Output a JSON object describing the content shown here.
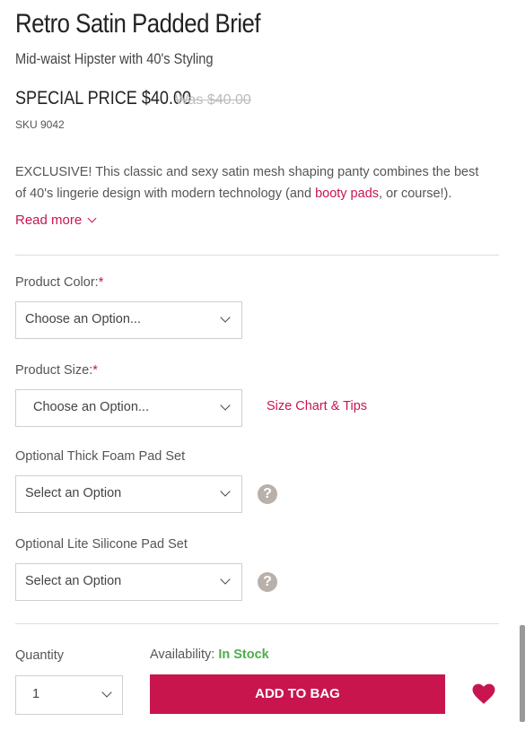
{
  "product": {
    "title": "Retro Satin Padded Brief",
    "subtitle": "Mid-waist Hipster with 40's Styling",
    "special_price": "SPECIAL PRICE $40.00",
    "was_price": "Was $40.00",
    "sku": "SKU 9042",
    "description_before": "EXCLUSIVE! This classic and sexy satin mesh shaping panty combines the best of 40's lingerie design with modern technology (and ",
    "description_link": "booty pads",
    "description_after": ", or course!).",
    "read_more": "Read more"
  },
  "options": {
    "color_label": "Product Color:",
    "color_required": "*",
    "color_value": "Choose an Option...",
    "size_label": "Product Size:",
    "size_required": "*",
    "size_value": "Choose an Option...",
    "size_chart_link": "Size Chart & Tips",
    "foam_label": "Optional Thick Foam Pad Set",
    "foam_value": "Select an Option",
    "silicone_label": "Optional Lite Silicone Pad Set",
    "silicone_value": "Select an Option",
    "help_glyph": "?"
  },
  "purchase": {
    "quantity_label": "Quantity",
    "quantity_value": "1",
    "availability_label": "Availability:",
    "availability_status": "In Stock",
    "add_to_bag": "ADD TO BAG"
  },
  "colors": {
    "accent": "#c8154e",
    "in_stock": "#4cae4c",
    "help_icon": "#b8b0aa"
  },
  "icons": [
    "chevron-down-icon",
    "question-icon",
    "heart-icon"
  ]
}
